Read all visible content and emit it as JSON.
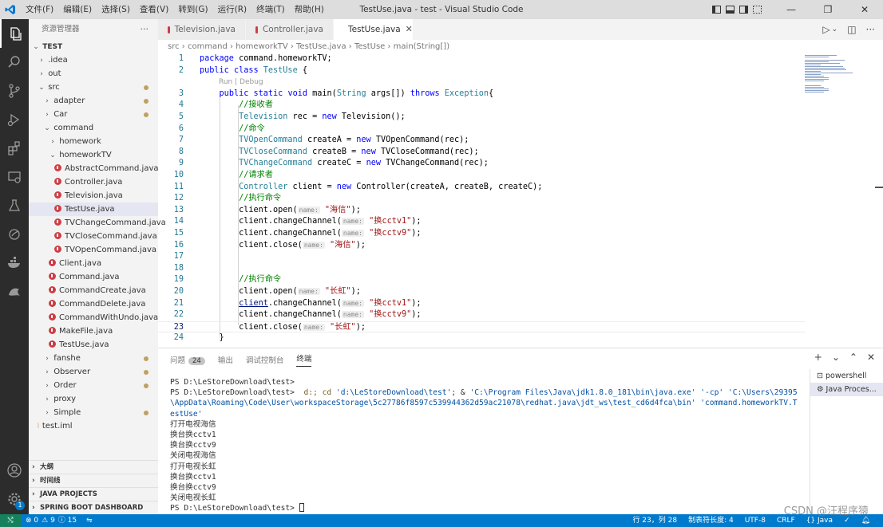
{
  "titlebar": {
    "menu": [
      "文件(F)",
      "编辑(E)",
      "选择(S)",
      "查看(V)",
      "转到(G)",
      "运行(R)",
      "终端(T)",
      "帮助(H)"
    ],
    "title": "TestUse.java - test - Visual Studio Code"
  },
  "sidebar": {
    "header": "资源管理器",
    "more": "···",
    "tree": [
      {
        "label": "TEST",
        "chev": "⌄",
        "indent": 0,
        "bold": true
      },
      {
        "label": ".idea",
        "chev": "›",
        "indent": 1
      },
      {
        "label": "out",
        "chev": "›",
        "indent": 1
      },
      {
        "label": "src",
        "chev": "⌄",
        "indent": 1,
        "dot": true
      },
      {
        "label": "adapter",
        "chev": "›",
        "indent": 2,
        "dot": true
      },
      {
        "label": "Car",
        "chev": "›",
        "indent": 2,
        "dot": true
      },
      {
        "label": "command",
        "chev": "⌄",
        "indent": 2
      },
      {
        "label": "homework",
        "chev": "›",
        "indent": 3
      },
      {
        "label": "homeworkTV",
        "chev": "⌄",
        "indent": 3
      },
      {
        "label": "AbstractCommand.java",
        "java": true,
        "indent": 4
      },
      {
        "label": "Controller.java",
        "java": true,
        "indent": 4
      },
      {
        "label": "Television.java",
        "java": true,
        "indent": 4
      },
      {
        "label": "TestUse.java",
        "java": true,
        "indent": 4,
        "selected": true
      },
      {
        "label": "TVChangeCommand.java",
        "java": true,
        "indent": 4
      },
      {
        "label": "TVCloseCommand.java",
        "java": true,
        "indent": 4
      },
      {
        "label": "TVOpenCommand.java",
        "java": true,
        "indent": 4
      },
      {
        "label": "Client.java",
        "java": true,
        "indent": 3
      },
      {
        "label": "Command.java",
        "java": true,
        "indent": 3
      },
      {
        "label": "CommandCreate.java",
        "java": true,
        "indent": 3
      },
      {
        "label": "CommandDelete.java",
        "java": true,
        "indent": 3
      },
      {
        "label": "CommandWithUndo.java",
        "java": true,
        "indent": 3
      },
      {
        "label": "MakeFile.java",
        "java": true,
        "indent": 3
      },
      {
        "label": "TestUse.java",
        "java": true,
        "indent": 3
      },
      {
        "label": "fanshe",
        "chev": "›",
        "indent": 2,
        "dot": true
      },
      {
        "label": "Observer",
        "chev": "›",
        "indent": 2,
        "dot": true
      },
      {
        "label": "Order",
        "chev": "›",
        "indent": 2,
        "dot": true
      },
      {
        "label": "proxy",
        "chev": "›",
        "indent": 2
      },
      {
        "label": "Simple",
        "chev": "›",
        "indent": 2,
        "dot": true
      },
      {
        "label": "test.iml",
        "xml": true,
        "indent": 1
      }
    ],
    "sections": [
      "大纲",
      "时间线",
      "JAVA PROJECTS",
      "SPRING BOOT DASHBOARD"
    ]
  },
  "tabs": [
    {
      "label": "Television.java",
      "active": false
    },
    {
      "label": "Controller.java",
      "active": false
    },
    {
      "label": "TestUse.java",
      "active": true
    }
  ],
  "tab_close": "✕",
  "breadcrumbs": "src  ›  command  ›  homeworkTV  ›  TestUse.java  ›  TestUse  ›  main(String[])",
  "codelens": "Run | Debug",
  "code": [
    {
      "n": "1",
      "h": "<span class='kw'>package</span> command.homeworkTV;"
    },
    {
      "n": "2",
      "h": "<span class='kw'>public</span> <span class='kw'>class</span> <span class='ty'>TestUse</span> {"
    },
    {
      "n": "3",
      "h": "    <span class='kw'>public</span> <span class='kw'>static</span> <span class='kw'>void</span> main(<span class='ty'>String</span> args[]) <span class='kw'>throws</span> <span class='ty'>Exception</span>{"
    },
    {
      "n": "4",
      "h": "        <span class='cm'>//接收者</span>"
    },
    {
      "n": "5",
      "h": "        <span class='ty'>Television</span> rec = <span class='kw'>new</span> Television();"
    },
    {
      "n": "6",
      "h": "        <span class='cm'>//命令</span>"
    },
    {
      "n": "7",
      "h": "        <span class='ty'>TVOpenCommand</span> createA = <span class='kw'>new</span> TVOpenCommand(rec);"
    },
    {
      "n": "8",
      "h": "        <span class='ty'>TVCloseCommand</span> createB = <span class='kw'>new</span> TVCloseCommand(rec);"
    },
    {
      "n": "9",
      "h": "        <span class='ty'>TVChangeCommand</span> createC = <span class='kw'>new</span> TVChangeCommand(rec);"
    },
    {
      "n": "10",
      "h": "        <span class='cm'>//请求者</span>"
    },
    {
      "n": "11",
      "h": "        <span class='ty'>Controller</span> client = <span class='kw'>new</span> Controller(createA, createB, createC);"
    },
    {
      "n": "12",
      "h": "        <span class='cm'>//执行命令</span>"
    },
    {
      "n": "13",
      "h": "        client.open(<span class='hint'>name:</span> <span class='st'>\"海信\"</span>);"
    },
    {
      "n": "14",
      "h": "        client.changeChannel(<span class='hint'>name:</span> <span class='st'>\"换cctv1\"</span>);"
    },
    {
      "n": "15",
      "h": "        client.changeChannel(<span class='hint'>name:</span> <span class='st'>\"换cctv9\"</span>);"
    },
    {
      "n": "16",
      "h": "        client.close(<span class='hint'>name:</span> <span class='st'>\"海信\"</span>);"
    },
    {
      "n": "17",
      "h": ""
    },
    {
      "n": "18",
      "h": ""
    },
    {
      "n": "19",
      "h": "        <span class='cm'>//执行命令</span>"
    },
    {
      "n": "20",
      "h": "        client.open(<span class='hint'>name:</span> <span class='st'>\"长虹\"</span>);"
    },
    {
      "n": "21",
      "h": "        <span style='text-decoration:underline;color:#001080'>client</span>.changeChannel(<span class='hint'>name:</span> <span class='st'>\"换cctv1\"</span>);"
    },
    {
      "n": "22",
      "h": "        client.changeChannel(<span class='hint'>name:</span> <span class='st'>\"换cctv9\"</span>);"
    },
    {
      "n": "23",
      "h": "        client.close(<span class='hint'>name:</span> <span class='st'>\"长虹\"</span>);",
      "current": true
    },
    {
      "n": "24",
      "h": "    }"
    }
  ],
  "panel": {
    "tabs": [
      "问题",
      "输出",
      "调试控制台",
      "终端"
    ],
    "problems_count": "24",
    "active_tab": "终端",
    "actions": [
      "+",
      "⌄",
      "⌃",
      "✕"
    ],
    "terminals": [
      "powershell",
      "Java Proces..."
    ],
    "prompt1": "PS D:\\LeStoreDownload\\test>",
    "prompt2": "PS D:\\LeStoreDownload\\test>",
    "cmd_cd": "d:; cd",
    "cmd_dir": "'d:\\LeStoreDownload\\test'",
    "cmd_amp": "; &",
    "cmd_java": "'C:\\Program Files\\Java\\jdk1.8.0_181\\bin\\java.exe'",
    "cmd_cp": "'-cp'",
    "cmd_rest": "'C:\\Users\\29395\\AppData\\Roaming\\Code\\User\\workspaceStorage\\5c27786f8597c539944362d59ac21078\\redhat.java\\jdt_ws\\test_cd6d4fca\\bin' 'command.homeworkTV.TestUse'",
    "output": [
      "打开电视海信",
      "换台换cctv1",
      "换台换cctv9",
      "关闭电视海信",
      "打开电视长虹",
      "换台换cctv1",
      "换台换cctv9",
      "关闭电视长虹"
    ],
    "prompt3": "PS D:\\LeStoreDownload\\test>"
  },
  "status": {
    "errors": "⊗ 0",
    "warnings": "⚠ 9",
    "info": "ⓘ 15",
    "position": "行 23，列 28",
    "tabsize": "制表符长度: 4",
    "encoding": "UTF-8",
    "eol": "CRLF",
    "language": "{} Java"
  },
  "watermark": "CSDN @汪程序猿",
  "colors": {
    "accent": "#007acc",
    "activity_bar": "#2c2c2c",
    "sidebar": "#f3f3f3",
    "java_icon": "#cc3e44"
  }
}
